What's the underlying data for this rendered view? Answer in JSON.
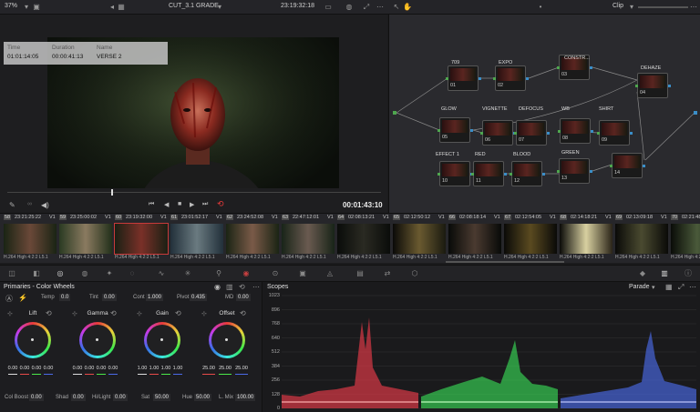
{
  "topbar": {
    "zoom": "37%",
    "title": "CUT_3.1 GRADE",
    "timecode": "23:19:32:18",
    "clip_mode": "Clip"
  },
  "viewer": {
    "hud": {
      "time_label": "Time",
      "time_value": "01:01:14:05",
      "duration_label": "Duration",
      "duration_value": "00:00:41:13",
      "name_label": "Name",
      "name_value": "VERSE 2"
    },
    "current_timecode": "00:01:43:10",
    "playhead": 0.35
  },
  "nodes": [
    {
      "num": "01",
      "label": "709"
    },
    {
      "num": "02",
      "label": "EXPO"
    },
    {
      "num": "03",
      "label": "CONSTR..."
    },
    {
      "num": "04",
      "label": "DEHAZE"
    },
    {
      "num": "05",
      "label": "GLOW"
    },
    {
      "num": "06",
      "label": "VIGNETTE"
    },
    {
      "num": "07",
      "label": "DEFOCUS"
    },
    {
      "num": "08",
      "label": "WB"
    },
    {
      "num": "09",
      "label": "SHIRT"
    },
    {
      "num": "10",
      "label": "EFFECT 1"
    },
    {
      "num": "11",
      "label": "RED"
    },
    {
      "num": "12",
      "label": "BLOOD"
    },
    {
      "num": "13",
      "label": "GREEN"
    },
    {
      "num": "14",
      "label": ""
    }
  ],
  "clips": [
    {
      "num": "58",
      "tc": "23:21:25:22",
      "track": "V1",
      "codec": "H.264 High 4:2:2 L5.1"
    },
    {
      "num": "59",
      "tc": "23:25:00:02",
      "track": "V1",
      "codec": "H.264 High 4:2:2 L5.1"
    },
    {
      "num": "60",
      "tc": "23:19:32:00",
      "track": "V1",
      "codec": "H.264 High 4:2:2 L5.1"
    },
    {
      "num": "61",
      "tc": "23:01:52:17",
      "track": "V1",
      "codec": "H.264 High 4:2:2 L5.1"
    },
    {
      "num": "62",
      "tc": "23:24:52:08",
      "track": "V1",
      "codec": "H.264 High 4:2:2 L5.1"
    },
    {
      "num": "63",
      "tc": "22:47:12:01",
      "track": "V1",
      "codec": "H.264 High 4:2:2 L5.1"
    },
    {
      "num": "64",
      "tc": "02:08:13:21",
      "track": "V1",
      "codec": "H.264 High 4:2:2 L5.1"
    },
    {
      "num": "65",
      "tc": "02:12:50:12",
      "track": "V1",
      "codec": "H.264 High 4:2:2 L5.1"
    },
    {
      "num": "66",
      "tc": "02:08:18:14",
      "track": "V1",
      "codec": "H.264 High 4:2:2 L5.1"
    },
    {
      "num": "67",
      "tc": "02:12:54:05",
      "track": "V1",
      "codec": "H.264 High 4:2:2 L5.1"
    },
    {
      "num": "68",
      "tc": "02:14:18:21",
      "track": "V1",
      "codec": "H.264 High 4:2:2 L5.1"
    },
    {
      "num": "69",
      "tc": "02:13:09:18",
      "track": "V1",
      "codec": "H.264 High 4:2:2 L5.1"
    },
    {
      "num": "70",
      "tc": "02:21:48:1",
      "track": "",
      "codec": "H.264 High 4:2:2 L5.1"
    }
  ],
  "primaries": {
    "title": "Primaries - Color Wheels",
    "temp_label": "Temp",
    "temp_value": "0.0",
    "tint_label": "Tint",
    "tint_value": "0.00",
    "cont_label": "Cont",
    "cont_value": "1.000",
    "pivot_label": "Pivot",
    "pivot_value": "0.435",
    "md_label": "MD",
    "md_value": "0.00",
    "wheels": [
      {
        "label": "Lift",
        "values": [
          "0.00",
          "0.00",
          "0.00",
          "0.00"
        ]
      },
      {
        "label": "Gamma",
        "values": [
          "0.00",
          "0.00",
          "0.00",
          "0.00"
        ]
      },
      {
        "label": "Gain",
        "values": [
          "1.00",
          "1.00",
          "1.00",
          "1.00"
        ]
      },
      {
        "label": "Offset",
        "values": [
          "25.00",
          "25.00",
          "25.00"
        ]
      }
    ],
    "colboost_label": "Col Boost",
    "colboost_value": "0.00",
    "shad_label": "Shad",
    "shad_value": "0.00",
    "hilight_label": "Hi/Light",
    "hilight_value": "0.00",
    "sat_label": "Sat",
    "sat_value": "50.00",
    "hue_label": "Hue",
    "hue_value": "50.00",
    "lmix_label": "L. Mix",
    "lmix_value": "100.00"
  },
  "scopes": {
    "title": "Scopes",
    "mode": "Parade",
    "y_ticks": [
      "1023",
      "896",
      "768",
      "640",
      "512",
      "384",
      "256",
      "128",
      "0"
    ]
  },
  "colors": {
    "accent_red": "#e83a3a",
    "parade_red": "#e83a4a",
    "parade_green": "#3ae85a",
    "parade_blue": "#4a6ae8"
  }
}
